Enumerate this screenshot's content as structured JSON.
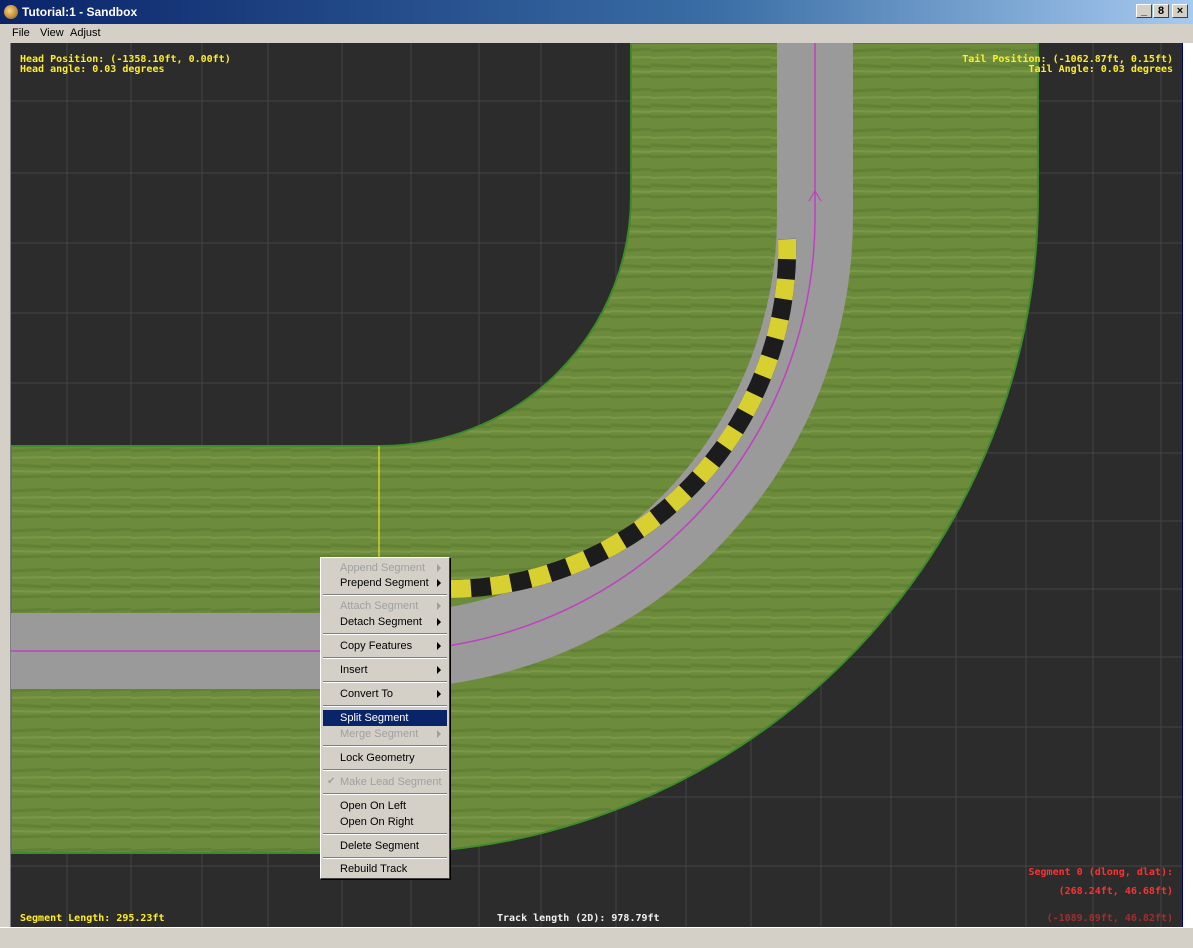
{
  "window": {
    "title": "Tutorial:1 - Sandbox",
    "min_label": "_",
    "max_label": "8",
    "close_label": "×"
  },
  "menubar": {
    "file": "File",
    "view": "View",
    "adjust": "Adjust"
  },
  "hud": {
    "head_position": "Head Position: (-1358.10ft, 0.00ft)",
    "head_angle": "Head angle: 0.03 degrees",
    "tail_position": "Tail Position: (-1062.87ft, 0.15ft)",
    "tail_angle": "Tail Angle: 0.03 degrees",
    "segment_info": "Segment 0 (dlong, dlat):",
    "segment_offsets": "(268.24ft, 46.68ft)",
    "segment_coords": "(-1089.89ft, 46.82ft)",
    "segment_length": "Segment Length: 295.23ft",
    "track_length": "Track length (2D): 978.79ft"
  },
  "context_menu": {
    "append_segment": "Append Segment",
    "prepend_segment": "Prepend Segment",
    "attach_segment": "Attach Segment",
    "detach_segment": "Detach Segment",
    "copy_features": "Copy Features",
    "insert": "Insert",
    "convert_to": "Convert To",
    "split_segment": "Split Segment",
    "merge_segment": "Merge Segment",
    "lock_geometry": "Lock Geometry",
    "make_lead_segment": "Make Lead Segment",
    "open_on_left": "Open On Left",
    "open_on_right": "Open On Right",
    "delete_segment": "Delete Segment",
    "rebuild_track": "Rebuild Track"
  },
  "colors": {
    "background": "#2c2c2c",
    "grass": "#6a8a3a",
    "asphalt": "#9a9a9a",
    "centerline": "#c040c0",
    "hud_yellow": "#ffee22",
    "hud_red": "#ff3030",
    "menu_highlight": "#0a246a"
  }
}
